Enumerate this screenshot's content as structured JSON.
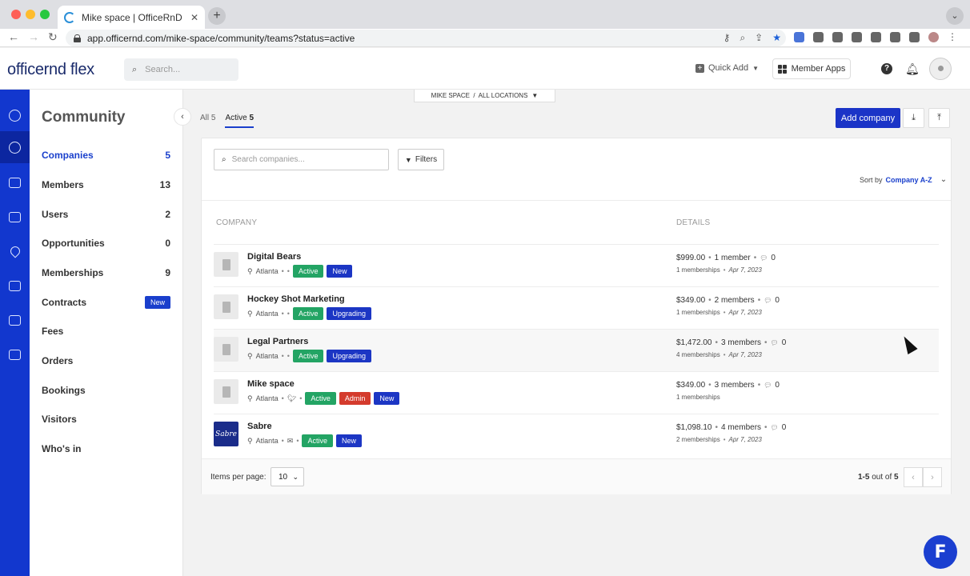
{
  "browser": {
    "tab_title": "Mike space | OfficeRnD",
    "url": "app.officernd.com/mike-space/community/teams?status=active"
  },
  "header": {
    "logo_light": "officernd",
    "logo_bold": "flex",
    "search_placeholder": "Search...",
    "quick_add": "Quick Add",
    "member_apps": "Member Apps"
  },
  "sidebar": {
    "title": "Community",
    "items": [
      {
        "label": "Companies",
        "count": "5"
      },
      {
        "label": "Members",
        "count": "13"
      },
      {
        "label": "Users",
        "count": "2"
      },
      {
        "label": "Opportunities",
        "count": "0"
      },
      {
        "label": "Memberships",
        "count": "9"
      },
      {
        "label": "Contracts",
        "badge": "New"
      },
      {
        "label": "Fees"
      },
      {
        "label": "Orders"
      },
      {
        "label": "Bookings"
      },
      {
        "label": "Visitors"
      },
      {
        "label": "Who's in"
      }
    ]
  },
  "main": {
    "location_bar": "MIKE SPACE  /  ALL LOCATIONS",
    "tab_all": "All",
    "tab_all_count": "5",
    "tab_active": "Active",
    "tab_active_count": "5",
    "add_company": "Add company",
    "search_placeholder": "Search companies...",
    "filters": "Filters",
    "sort_label": "Sort by",
    "sort_value": "Company A-Z",
    "col_company": "COMPANY",
    "col_details": "DETAILS",
    "companies": [
      {
        "name": "Digital Bears",
        "location": "Atlanta",
        "tags": [
          "Active",
          "New"
        ],
        "price": "$999.00",
        "members": "1 member",
        "messages": "0",
        "memberships": "1 memberships",
        "date": "Apr 7, 2023"
      },
      {
        "name": "Hockey Shot Marketing",
        "location": "Atlanta",
        "tags": [
          "Active",
          "Upgrading"
        ],
        "price": "$349.00",
        "members": "2 members",
        "messages": "0",
        "memberships": "1 memberships",
        "date": "Apr 7, 2023"
      },
      {
        "name": "Legal Partners",
        "location": "Atlanta",
        "tags": [
          "Active",
          "Upgrading"
        ],
        "price": "$1,472.00",
        "members": "3 members",
        "messages": "0",
        "memberships": "4 memberships",
        "date": "Apr 7, 2023"
      },
      {
        "name": "Mike space",
        "location": "Atlanta",
        "tags": [
          "Active",
          "Admin",
          "New"
        ],
        "price": "$349.00",
        "members": "3 members",
        "messages": "0",
        "memberships": "1 memberships",
        "date": ""
      },
      {
        "name": "Sabre",
        "location": "Atlanta",
        "tags": [
          "Active",
          "New"
        ],
        "price": "$1,098.10",
        "members": "4 members",
        "messages": "0",
        "memberships": "2 memberships",
        "date": "Apr 7, 2023",
        "logo_text": "Sabre"
      }
    ],
    "items_per_page_label": "Items per page:",
    "items_per_page": "10",
    "range": "1-5",
    "out_of": "out of",
    "total": "5"
  },
  "colors": {
    "brand_blue": "#1b34c7",
    "rail_blue": "#1237ce",
    "active_green": "#23a464",
    "admin_red": "#d43b2d"
  }
}
